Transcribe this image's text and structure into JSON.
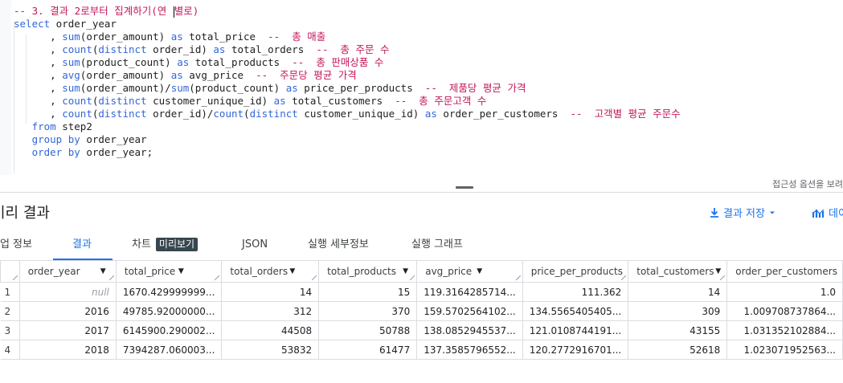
{
  "editor": {
    "lines": [
      [
        {
          "t": "-- 3. 결과 2로부터 집계하기(연 ",
          "c": "cm"
        },
        {
          "t": "cursor",
          "c": "cursor"
        },
        {
          "t": "별로)",
          "c": "cm"
        }
      ],
      [
        {
          "t": "select",
          "c": "kw"
        },
        {
          "t": " order_year",
          "c": "tx"
        }
      ],
      [
        {
          "t": "      , ",
          "c": "tx"
        },
        {
          "t": "sum",
          "c": "kw"
        },
        {
          "t": "(order_amount) ",
          "c": "tx"
        },
        {
          "t": "as",
          "c": "kw"
        },
        {
          "t": " total_price  ",
          "c": "tx"
        },
        {
          "t": "--  총 매출",
          "c": "cm"
        }
      ],
      [
        {
          "t": "      , ",
          "c": "tx"
        },
        {
          "t": "count",
          "c": "kw"
        },
        {
          "t": "(",
          "c": "tx"
        },
        {
          "t": "distinct",
          "c": "kw"
        },
        {
          "t": " order_id) ",
          "c": "tx"
        },
        {
          "t": "as",
          "c": "kw"
        },
        {
          "t": " total_orders  ",
          "c": "tx"
        },
        {
          "t": "--  총 주문 수",
          "c": "cm"
        }
      ],
      [
        {
          "t": "      , ",
          "c": "tx"
        },
        {
          "t": "sum",
          "c": "kw"
        },
        {
          "t": "(product_count) ",
          "c": "tx"
        },
        {
          "t": "as",
          "c": "kw"
        },
        {
          "t": " total_products  ",
          "c": "tx"
        },
        {
          "t": "--  총 판매상품 수",
          "c": "cm"
        }
      ],
      [
        {
          "t": "      , ",
          "c": "tx"
        },
        {
          "t": "avg",
          "c": "kw"
        },
        {
          "t": "(order_amount) ",
          "c": "tx"
        },
        {
          "t": "as",
          "c": "kw"
        },
        {
          "t": " avg_price  ",
          "c": "tx"
        },
        {
          "t": "--  주문당 평균 가격",
          "c": "cm"
        }
      ],
      [
        {
          "t": "      , ",
          "c": "tx"
        },
        {
          "t": "sum",
          "c": "kw"
        },
        {
          "t": "(order_amount)/",
          "c": "tx"
        },
        {
          "t": "sum",
          "c": "kw"
        },
        {
          "t": "(product_count) ",
          "c": "tx"
        },
        {
          "t": "as",
          "c": "kw"
        },
        {
          "t": " price_per_products  ",
          "c": "tx"
        },
        {
          "t": "--  제품당 평균 가격",
          "c": "cm"
        }
      ],
      [
        {
          "t": "      , ",
          "c": "tx"
        },
        {
          "t": "count",
          "c": "kw"
        },
        {
          "t": "(",
          "c": "tx"
        },
        {
          "t": "distinct",
          "c": "kw"
        },
        {
          "t": " customer_unique_id) ",
          "c": "tx"
        },
        {
          "t": "as",
          "c": "kw"
        },
        {
          "t": " total_customers  ",
          "c": "tx"
        },
        {
          "t": "--  총 주문고객 수",
          "c": "cm"
        }
      ],
      [
        {
          "t": "      , ",
          "c": "tx"
        },
        {
          "t": "count",
          "c": "kw"
        },
        {
          "t": "(",
          "c": "tx"
        },
        {
          "t": "distinct",
          "c": "kw"
        },
        {
          "t": " order_id)/",
          "c": "tx"
        },
        {
          "t": "count",
          "c": "kw"
        },
        {
          "t": "(",
          "c": "tx"
        },
        {
          "t": "distinct",
          "c": "kw"
        },
        {
          "t": " customer_unique_id) ",
          "c": "tx"
        },
        {
          "t": "as",
          "c": "kw"
        },
        {
          "t": " order_per_customers  ",
          "c": "tx"
        },
        {
          "t": "--  고객별 평균 주문수",
          "c": "cm"
        }
      ],
      [
        {
          "t": "   ",
          "c": "tx"
        },
        {
          "t": "from",
          "c": "kw"
        },
        {
          "t": " step2",
          "c": "tx"
        }
      ],
      [
        {
          "t": "   ",
          "c": "tx"
        },
        {
          "t": "group by",
          "c": "kw"
        },
        {
          "t": " order_year",
          "c": "tx"
        }
      ],
      [
        {
          "t": "   ",
          "c": "tx"
        },
        {
          "t": "order by",
          "c": "kw"
        },
        {
          "t": " order_year;",
          "c": "tx"
        }
      ]
    ],
    "a11y_text": "접근성 옵션을 보려",
    "colors": {
      "keyword": "#3367d6",
      "comment": "#c2185b"
    }
  },
  "results": {
    "title": "미리 결과",
    "save_label": "결과 저장",
    "explore_label": "데이",
    "tabs": [
      {
        "label": "작업 정보"
      },
      {
        "label": "결과",
        "active": true
      },
      {
        "label": "차트"
      },
      {
        "label": "JSON"
      },
      {
        "label": "실행 세부정보"
      },
      {
        "label": "실행 그래프"
      }
    ],
    "preview_badge": "미리보기",
    "columns": [
      "order_year",
      "total_price",
      "total_orders",
      "total_products",
      "avg_price",
      "price_per_products",
      "total_customers",
      "order_per_customers"
    ],
    "rows": [
      {
        "n": "1",
        "cells": [
          "null",
          "1670.429999999...",
          "14",
          "15",
          "119.3164285714...",
          "111.362",
          "14",
          "1.0"
        ]
      },
      {
        "n": "2",
        "cells": [
          "2016",
          "49785.92000000...",
          "312",
          "370",
          "159.5702564102...",
          "134.5565405405...",
          "309",
          "1.009708737864..."
        ]
      },
      {
        "n": "3",
        "cells": [
          "2017",
          "6145900.290002...",
          "44508",
          "50788",
          "138.0852945537...",
          "121.0108744191...",
          "43155",
          "1.031352102884..."
        ]
      },
      {
        "n": "4",
        "cells": [
          "2018",
          "7394287.060003...",
          "53832",
          "61477",
          "137.3585796552...",
          "120.2772916701...",
          "52618",
          "1.023071952563..."
        ]
      }
    ]
  }
}
